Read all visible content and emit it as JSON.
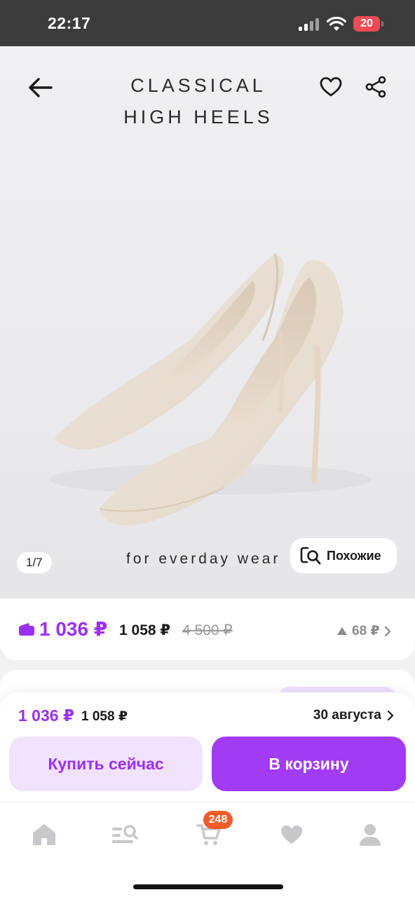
{
  "status_bar": {
    "time": "22:17",
    "battery": "20",
    "icons": [
      "signal-icon",
      "wifi-icon",
      "battery-icon"
    ],
    "battery_color": "#ef4b52"
  },
  "product": {
    "image_title": "CLASSICAL\nHIGH HEELS",
    "image_tagline": "for everday wear",
    "image_counter": "1/7",
    "similar_label": "Похожие"
  },
  "header_icons": [
    "back-arrow-icon",
    "heart-icon",
    "share-icon"
  ],
  "price_card": {
    "price": "1 036 ₽",
    "price_without_wallet": "1 058 ₽",
    "old_price": "4 500 ₽",
    "price_change": "68 ₽",
    "accent_color": "#9b30f5"
  },
  "purchase_sheet": {
    "price": "1 036 ₽",
    "price_without_wallet": "1 058 ₽",
    "delivery_date": "30 августа",
    "buy_now_label": "Купить сейчас",
    "add_to_cart_label": "В корзину"
  },
  "bottom_nav": {
    "items": [
      "home-icon",
      "catalog-search-icon",
      "cart-icon",
      "favorites-icon",
      "profile-icon"
    ],
    "cart_badge": "248",
    "badge_color": "#f25c2a"
  }
}
